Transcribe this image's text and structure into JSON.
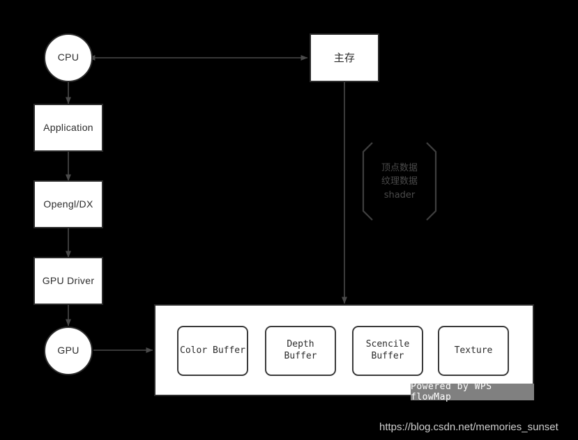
{
  "diagram": {
    "background_color": "#000000",
    "node_fill": "#ffffff",
    "node_stroke": "#2b2b2b",
    "edge_color": "#4a4a4a",
    "nodes": [
      {
        "id": "cpu",
        "label": "CPU",
        "shape": "circle"
      },
      {
        "id": "application",
        "label": "Application",
        "shape": "rect"
      },
      {
        "id": "opengl_dx",
        "label": "Opengl/DX",
        "shape": "rect"
      },
      {
        "id": "gpu_driver",
        "label": "GPU Driver",
        "shape": "rect"
      },
      {
        "id": "gpu",
        "label": "GPU",
        "shape": "circle"
      },
      {
        "id": "main_memory",
        "label": "主存",
        "shape": "rect"
      }
    ],
    "bracket_note": "顶点数据\n纹理数据\nshader",
    "framebuffer_panel": {
      "buffers": [
        {
          "id": "color_buffer",
          "label": "Color Buffer"
        },
        {
          "id": "depth_buffer",
          "label": "Depth\nBuffer"
        },
        {
          "id": "stencil_buffer",
          "label": "Scencile\nBuffer"
        },
        {
          "id": "texture",
          "label": "Texture"
        }
      ]
    },
    "edges": [
      {
        "from": "cpu",
        "to": "main_memory",
        "direction": "bidirectional"
      },
      {
        "from": "cpu",
        "to": "application",
        "direction": "forward"
      },
      {
        "from": "application",
        "to": "opengl_dx",
        "direction": "forward"
      },
      {
        "from": "opengl_dx",
        "to": "gpu_driver",
        "direction": "forward"
      },
      {
        "from": "gpu_driver",
        "to": "gpu",
        "direction": "forward"
      },
      {
        "from": "gpu",
        "to": "framebuffer_panel",
        "direction": "forward"
      },
      {
        "from": "main_memory",
        "to": "framebuffer_panel",
        "direction": "forward"
      }
    ]
  },
  "watermark": {
    "text": "Powered by WPS flowMap",
    "background_color": "#808080",
    "text_color": "#ffffff"
  },
  "footer": {
    "url": "https://blog.csdn.net/memories_sunset",
    "text_color": "#cfcfcf"
  }
}
